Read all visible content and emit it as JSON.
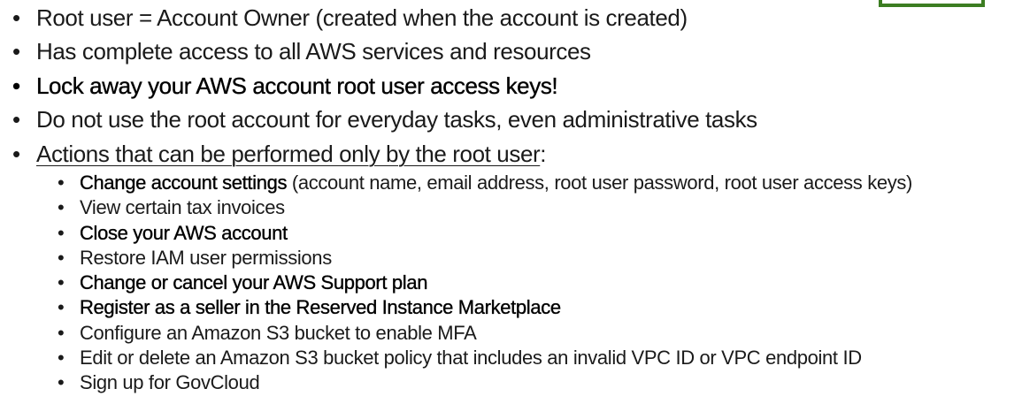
{
  "points": [
    {
      "text": "Root user = Account Owner (created when the account is created)"
    },
    {
      "text": "Has complete access to all AWS services and resources"
    },
    {
      "text": "Lock away your AWS account root user access keys!"
    },
    {
      "text": "Do not use the root account for everyday tasks, even administrative tasks"
    },
    {
      "text": "Actions that can be performed only by the root user",
      "suffix": ":"
    }
  ],
  "actions": [
    {
      "bold": "Change account settings",
      "rest": " (account name, email address, root user password, root user access keys)"
    },
    {
      "rest": "View certain tax invoices"
    },
    {
      "bold": "Close your AWS account"
    },
    {
      "rest": "Restore IAM user permissions"
    },
    {
      "bold": "Change or cancel your AWS Support plan"
    },
    {
      "bold": "Register as a seller in the Reserved Instance Marketplace"
    },
    {
      "rest": "Configure an Amazon S3 bucket to enable MFA"
    },
    {
      "rest": "Edit or delete an Amazon S3 bucket policy that includes an invalid VPC ID or VPC endpoint ID"
    },
    {
      "rest": "Sign up for GovCloud"
    }
  ],
  "colors": {
    "accent_box": "#3c7d22",
    "text": "#1a1a1a"
  }
}
